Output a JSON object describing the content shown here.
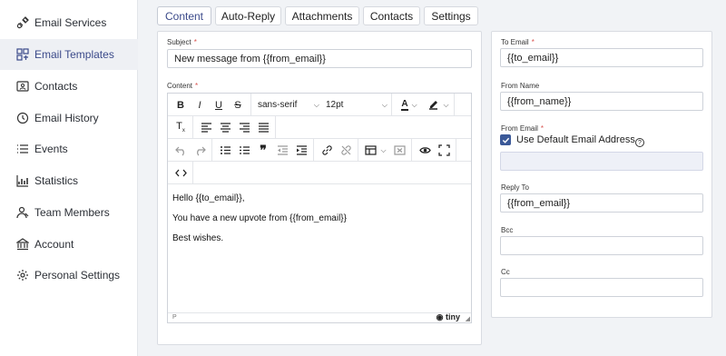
{
  "sidebar": {
    "items": [
      {
        "label": "Email Services",
        "icon": "plug-icon"
      },
      {
        "label": "Email Templates",
        "icon": "templates-icon",
        "active": true
      },
      {
        "label": "Contacts",
        "icon": "contacts-icon"
      },
      {
        "label": "Email History",
        "icon": "history-icon"
      },
      {
        "label": "Events",
        "icon": "list-icon"
      },
      {
        "label": "Statistics",
        "icon": "chart-icon"
      },
      {
        "label": "Team Members",
        "icon": "team-icon"
      },
      {
        "label": "Account",
        "icon": "bank-icon"
      },
      {
        "label": "Personal Settings",
        "icon": "gear-icon"
      }
    ]
  },
  "tabs": [
    {
      "label": "Content",
      "active": true
    },
    {
      "label": "Auto-Reply"
    },
    {
      "label": "Attachments"
    },
    {
      "label": "Contacts"
    },
    {
      "label": "Settings"
    }
  ],
  "form": {
    "subject_label": "Subject",
    "subject_value": "New message from {{from_email}}",
    "content_label": "Content",
    "required_mark": "*"
  },
  "editor": {
    "font_family": "sans-serif",
    "font_size": "12pt",
    "content": [
      "Hello {{to_email}},",
      "You have a new upvote from {{from_email}}",
      "Best wishes."
    ],
    "status_path": "P",
    "brand": "tiny"
  },
  "right": {
    "to_email_label": "To Email",
    "to_email_value": "{{to_email}}",
    "from_name_label": "From Name",
    "from_name_value": "{{from_name}}",
    "from_email_label": "From Email",
    "use_default_label": "Use Default Email Address",
    "use_default_checked": true,
    "from_email_value": "",
    "reply_to_label": "Reply To",
    "reply_to_value": "{{from_email}}",
    "bcc_label": "Bcc",
    "bcc_value": "",
    "cc_label": "Cc",
    "cc_value": ""
  },
  "colors": {
    "accent": "#3b4a8a",
    "checkbox": "#3b5998",
    "required": "#d9534f"
  }
}
